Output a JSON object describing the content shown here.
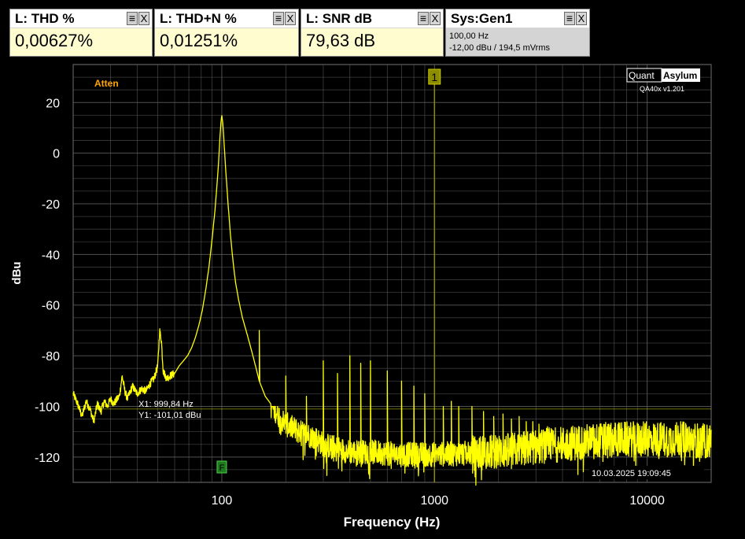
{
  "panels": [
    {
      "title": "L: THD %",
      "value": "0,00627%"
    },
    {
      "title": "L: THD+N %",
      "value": "0,01251%"
    },
    {
      "title": "L: SNR dB",
      "value": "79,63 dB"
    }
  ],
  "sys_panel": {
    "title": "Sys:Gen1",
    "line1": "100,00 Hz",
    "line2": "-12,00 dBu  / 194,5 mVrms"
  },
  "panel_buttons": {
    "menu": "≡",
    "close": "X"
  },
  "logo": {
    "part1": "Quant",
    "part2": "Asylum",
    "version": "QA40x v1.201"
  },
  "atten_label": "Atten",
  "marker": {
    "label": "1",
    "x_hz": 1000
  },
  "f_marker": {
    "label": "F",
    "x_hz": 100
  },
  "cursor_readout": {
    "x_text": "X1: 999,84 Hz",
    "y_text": "Y1: -101,01 dBu",
    "y_value": -101.01
  },
  "timestamp": "10.03.2025 19:09:45",
  "colors": {
    "trace": "#ffff00",
    "marker": "#8c8c00",
    "atten": "#ffa500",
    "grid": "#5a5a5a",
    "background": "#000000"
  },
  "chart_data": {
    "type": "line",
    "xlabel": "Frequency (Hz)",
    "ylabel": "dBu",
    "x_scale": "log",
    "xlim": [
      20,
      20000
    ],
    "ylim": [
      -130,
      35
    ],
    "x_ticks": [
      {
        "value": 100,
        "label": "100"
      },
      {
        "value": 1000,
        "label": "1000"
      },
      {
        "value": 10000,
        "label": "10000"
      }
    ],
    "y_ticks": [
      20,
      0,
      -20,
      -40,
      -60,
      -80,
      -100,
      -120
    ],
    "grid": true,
    "series": [
      {
        "color": "#ffff00",
        "base_points": [
          [
            20,
            -95
          ],
          [
            21,
            -99
          ],
          [
            22,
            -104
          ],
          [
            23,
            -98
          ],
          [
            24,
            -101
          ],
          [
            25,
            -106
          ],
          [
            26,
            -99
          ],
          [
            27,
            -102
          ],
          [
            28,
            -98
          ],
          [
            29,
            -100
          ],
          [
            30,
            -97
          ],
          [
            31,
            -99
          ],
          [
            33,
            -96
          ],
          [
            34,
            -88
          ],
          [
            35,
            -94
          ],
          [
            36,
            -97
          ],
          [
            38,
            -92
          ],
          [
            40,
            -95
          ],
          [
            42,
            -93
          ],
          [
            44,
            -94
          ],
          [
            46,
            -91
          ],
          [
            48,
            -89
          ],
          [
            50,
            -84
          ],
          [
            51,
            -70
          ],
          [
            52,
            -74
          ],
          [
            53,
            -86
          ],
          [
            55,
            -89
          ],
          [
            57,
            -88
          ],
          [
            60,
            -87
          ],
          [
            63,
            -84
          ],
          [
            66,
            -82
          ],
          [
            69,
            -80
          ],
          [
            72,
            -77
          ],
          [
            75,
            -73
          ],
          [
            78,
            -68
          ],
          [
            81,
            -62
          ],
          [
            84,
            -54
          ],
          [
            87,
            -45
          ],
          [
            90,
            -34
          ],
          [
            93,
            -22
          ],
          [
            96,
            -7
          ],
          [
            98,
            6
          ],
          [
            99,
            12
          ],
          [
            100,
            15
          ],
          [
            101,
            12
          ],
          [
            102,
            7
          ],
          [
            104,
            -5
          ],
          [
            107,
            -20
          ],
          [
            110,
            -33
          ],
          [
            113,
            -43
          ],
          [
            116,
            -51
          ],
          [
            120,
            -58
          ],
          [
            125,
            -65
          ],
          [
            130,
            -70
          ],
          [
            135,
            -75
          ],
          [
            140,
            -80
          ],
          [
            145,
            -85
          ],
          [
            150,
            -90
          ],
          [
            155,
            -93
          ],
          [
            160,
            -96
          ],
          [
            170,
            -99
          ],
          [
            180,
            -102
          ],
          [
            190,
            -105
          ],
          [
            200,
            -107
          ],
          [
            230,
            -110
          ],
          [
            270,
            -112
          ],
          [
            300,
            -115
          ],
          [
            400,
            -118
          ],
          [
            500,
            -118
          ],
          [
            700,
            -119
          ],
          [
            1000,
            -119
          ],
          [
            2000,
            -118
          ],
          [
            3000,
            -116
          ],
          [
            5000,
            -114
          ],
          [
            7000,
            -113
          ],
          [
            10000,
            -113
          ],
          [
            15000,
            -113
          ],
          [
            20000,
            -114
          ]
        ],
        "spikes": [
          [
            150,
            -70
          ],
          [
            200,
            -88
          ],
          [
            250,
            -96
          ],
          [
            300,
            -82
          ],
          [
            350,
            -87
          ],
          [
            400,
            -80
          ],
          [
            450,
            -83
          ],
          [
            500,
            -82
          ],
          [
            600,
            -86
          ],
          [
            700,
            -90
          ],
          [
            800,
            -92
          ],
          [
            900,
            -95
          ],
          [
            1100,
            -100
          ],
          [
            1200,
            -98
          ],
          [
            1300,
            -100
          ],
          [
            1500,
            -100
          ],
          [
            1700,
            -102
          ],
          [
            1900,
            -104
          ],
          [
            2100,
            -103
          ],
          [
            2300,
            -105
          ],
          [
            2500,
            -104
          ],
          [
            2700,
            -106
          ],
          [
            2900,
            -106
          ],
          [
            3100,
            -107
          ],
          [
            3400,
            -108
          ]
        ],
        "noise_floor": {
          "from_hz": 170,
          "to_hz": 20000,
          "range_db": [
            -110,
            -125
          ]
        }
      }
    ]
  }
}
